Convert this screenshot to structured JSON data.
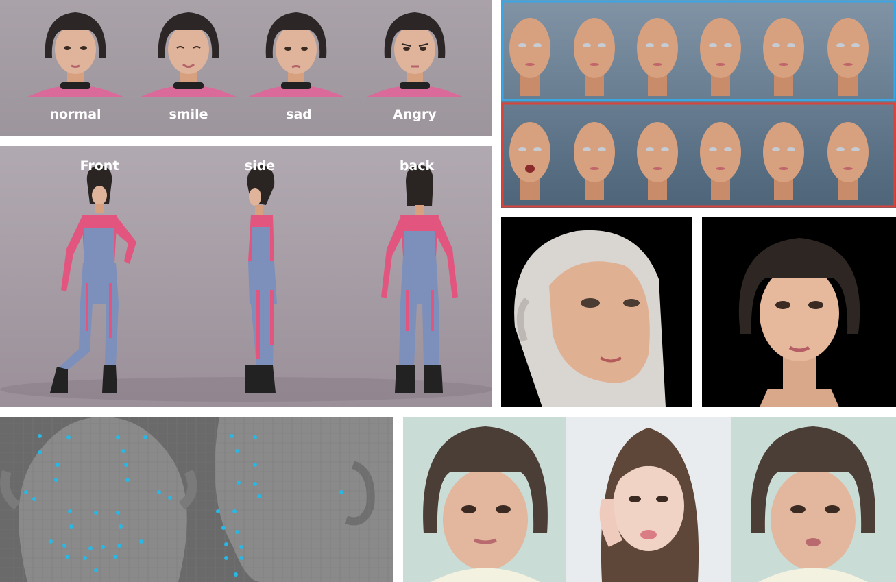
{
  "expressions": {
    "labels": [
      "normal",
      "smile",
      "sad",
      "Angry"
    ]
  },
  "turnaround": {
    "labels": [
      "Front",
      "side",
      "back"
    ]
  },
  "blendshape_grid": {
    "top_border_color": "#3aa7e4",
    "bottom_border_color": "#d9433a"
  },
  "colors": {
    "panel_gray": "#a89ea6",
    "grid_bg": "#5d7286",
    "skin": "#d7a07e",
    "hair": "#2a2522",
    "top_pink": "#e2557f",
    "jeans": "#7d8fbb",
    "mocap_dot": "#27b8e6"
  }
}
